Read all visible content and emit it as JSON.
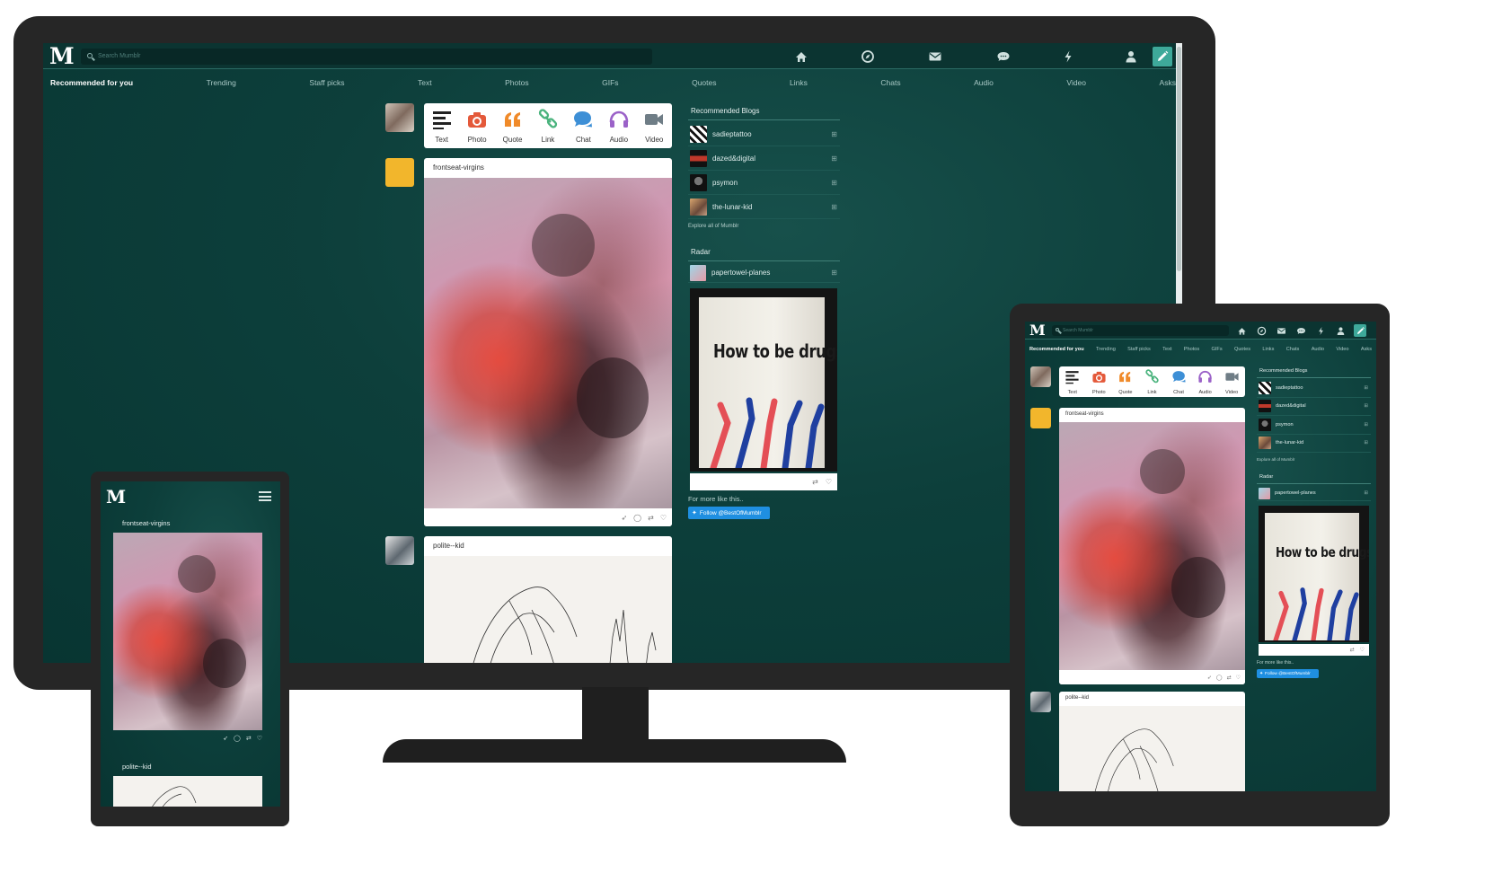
{
  "app": {
    "logo": "M",
    "search_placeholder": "Search Mumblr"
  },
  "nav_icons": [
    "home-icon",
    "compass-icon",
    "mail-icon",
    "chat-bubble-icon",
    "lightning-icon",
    "user-icon",
    "pencil-icon"
  ],
  "tabs": [
    {
      "label": "Recommended for you",
      "active": true
    },
    {
      "label": "Trending"
    },
    {
      "label": "Staff picks"
    },
    {
      "label": "Text"
    },
    {
      "label": "Photos"
    },
    {
      "label": "GIFs"
    },
    {
      "label": "Quotes"
    },
    {
      "label": "Links"
    },
    {
      "label": "Chats"
    },
    {
      "label": "Audio"
    },
    {
      "label": "Video"
    },
    {
      "label": "Asks"
    }
  ],
  "composer": [
    {
      "label": "Text",
      "icon": "text-icon",
      "color": "#222222"
    },
    {
      "label": "Photo",
      "icon": "camera-icon",
      "color": "#e4593a"
    },
    {
      "label": "Quote",
      "icon": "quote-icon",
      "color": "#f08a29"
    },
    {
      "label": "Link",
      "icon": "link-icon",
      "color": "#4ab37d"
    },
    {
      "label": "Chat",
      "icon": "chat-icon",
      "color": "#3d8fd6"
    },
    {
      "label": "Audio",
      "icon": "headphones-icon",
      "color": "#9b62c8"
    },
    {
      "label": "Video",
      "icon": "video-camera-icon",
      "color": "#6f7d86"
    }
  ],
  "posts": [
    {
      "blog": "frontseat-virgins"
    },
    {
      "blog": "polite--kid"
    }
  ],
  "sidebar": {
    "recommended_title": "Recommended Blogs",
    "blogs": [
      "sadieptattoo",
      "dazed&digital",
      "psymon",
      "the-lunar-kid"
    ],
    "explore_link": "Explore all of Mumblr",
    "radar_title": "Radar",
    "radar_blog": "papertowel-planes",
    "radar_book_title": "How to be drugs",
    "more_like_this": "For more like this..",
    "follow_label": "Follow @BestOfMumblr"
  },
  "colors": {
    "background": "#0d3f3b",
    "accent": "#3ea99a",
    "twitter": "#1f8fe1"
  }
}
